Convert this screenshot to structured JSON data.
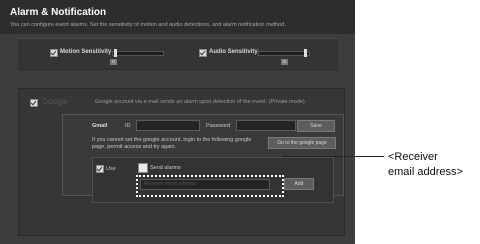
{
  "panel": {
    "title": "Alarm & Notification",
    "description": "You can configure event alarms. Set the sensitivity of motion and audio detections, and alarm notification method."
  },
  "motion": {
    "label": "Motion Sensitivity",
    "value": "0",
    "level": 0.05
  },
  "audio": {
    "label": "Audio Sensitivity",
    "value": "8",
    "level": 0.9
  },
  "google": {
    "logo": "Google",
    "description": "Google account via e-mail sends an alarm upon detection of the event. (Private mode)",
    "gmail_label": "Gmail",
    "id_label": "ID",
    "password_label": "Password",
    "save_label": "Save",
    "help_text": "If you cannot set the google account, login to the following google page, permit access and try again.",
    "goto_label": "Go to the google page",
    "use_label": "Use",
    "send_alarms_label": "Send alarms",
    "receiver_placeholder": "Receiver email address",
    "add_label": "Add"
  },
  "annotation": {
    "line1": "<Receiver",
    "line2": "email address>"
  }
}
